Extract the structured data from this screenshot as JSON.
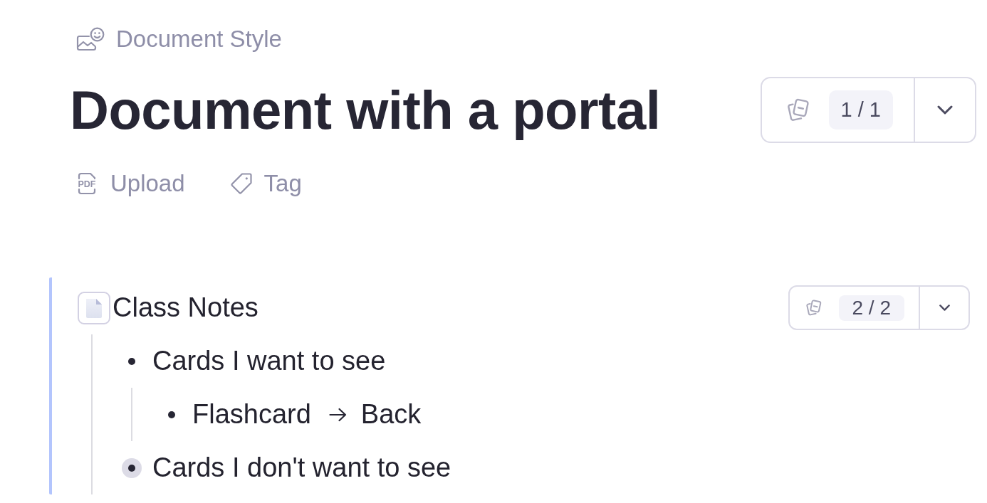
{
  "header": {
    "breadcrumb": {
      "label": "Document Style"
    },
    "title": "Document with a portal",
    "page_counter": {
      "count": "1 / 1"
    },
    "actions": [
      {
        "label": "Upload",
        "icon_label": "PDF"
      },
      {
        "label": "Tag"
      }
    ]
  },
  "portal": {
    "title": "Class Notes",
    "page_counter": {
      "count": "2 / 2"
    },
    "items": [
      {
        "kind": "text",
        "text": "Cards I want to see",
        "collapsed": false,
        "children": [
          {
            "kind": "flashcard",
            "front": "Flashcard",
            "back": "Back",
            "collapsed": false
          }
        ]
      },
      {
        "kind": "text",
        "text": "Cards I don't want to see",
        "collapsed": true
      }
    ]
  }
}
